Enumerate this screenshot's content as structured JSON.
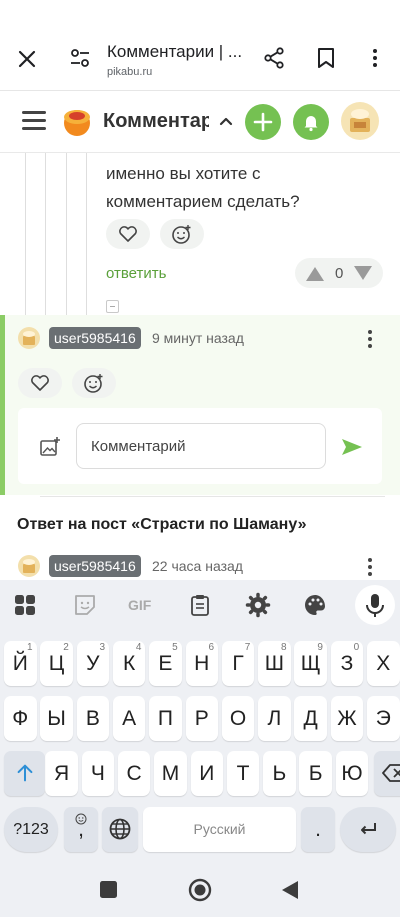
{
  "browser": {
    "title": "Комментарии | ...",
    "url": "pikabu.ru"
  },
  "site": {
    "title": "Комментарии",
    "accent": "#75c152"
  },
  "comment": {
    "text": "именно вы хотите с комментарием сделать?",
    "reply_label": "ответить",
    "votes": "0"
  },
  "reply": {
    "username": "user5985416",
    "time": "9 минут назад",
    "input_placeholder": "Комментарий"
  },
  "next_post": {
    "title": "Ответ на пост «Страсти по Шаману»",
    "username": "user5985416",
    "time": "22 часа назад"
  },
  "keyboard": {
    "toolbar": [
      "apps-icon",
      "sticker-icon",
      "gif-icon",
      "clipboard-icon",
      "settings-icon",
      "palette-icon",
      "mic-icon"
    ],
    "gif_label": "GIF",
    "row1": [
      {
        "k": "Й",
        "h": "1"
      },
      {
        "k": "Ц",
        "h": "2"
      },
      {
        "k": "У",
        "h": "3"
      },
      {
        "k": "К",
        "h": "4"
      },
      {
        "k": "Е",
        "h": "5"
      },
      {
        "k": "Н",
        "h": "6"
      },
      {
        "k": "Г",
        "h": "7"
      },
      {
        "k": "Ш",
        "h": "8"
      },
      {
        "k": "Щ",
        "h": "9"
      },
      {
        "k": "З",
        "h": "0"
      },
      {
        "k": "Х",
        "h": ""
      }
    ],
    "row2": [
      "Ф",
      "Ы",
      "В",
      "А",
      "П",
      "Р",
      "О",
      "Л",
      "Д",
      "Ж",
      "Э"
    ],
    "row3": [
      "Я",
      "Ч",
      "С",
      "М",
      "И",
      "Т",
      "Ь",
      "Б",
      "Ю"
    ],
    "symbols_label": "?123",
    "comma_label": ",",
    "space_label": "Русский",
    "period_label": "."
  }
}
